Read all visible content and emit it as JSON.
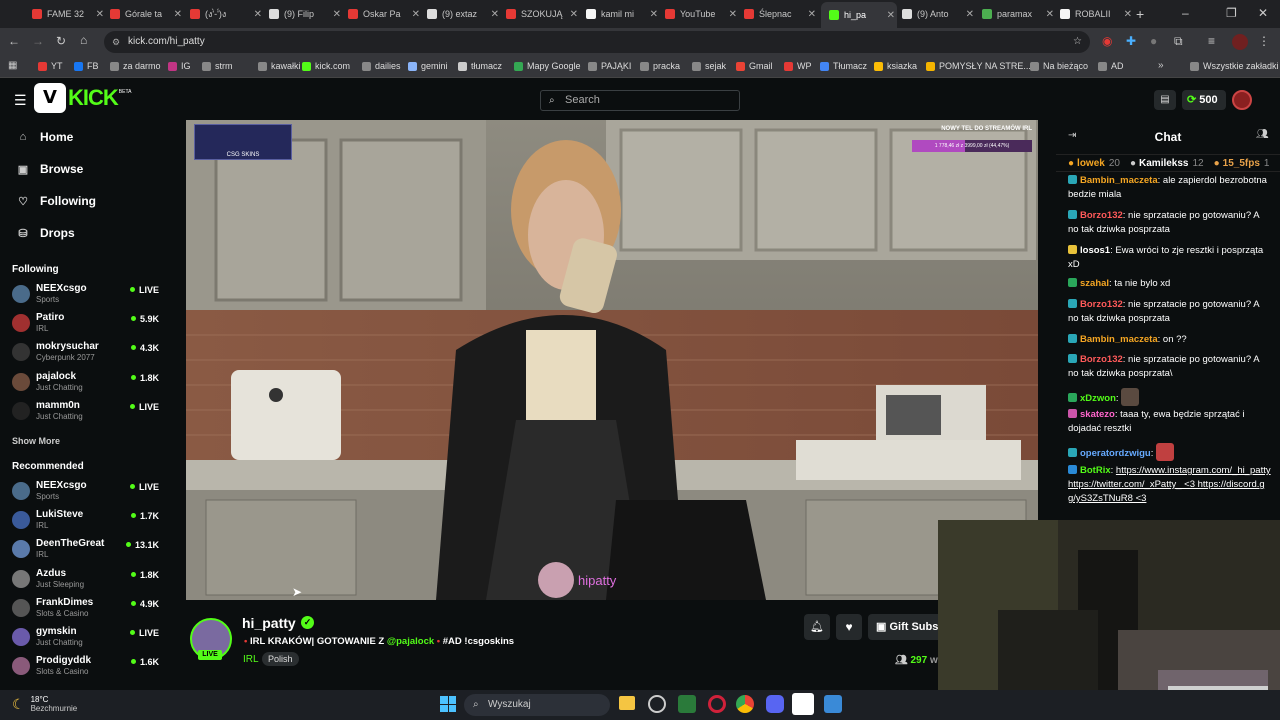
{
  "tabs": [
    {
      "label": "FAME 32",
      "color": "#e53935"
    },
    {
      "label": "Górale ta",
      "color": "#e53935"
    },
    {
      "label": "(ง'̀-'́)ง",
      "color": "#e53935"
    },
    {
      "label": "(9) Filip",
      "color": "#dddddd"
    },
    {
      "label": "Oskar Pa",
      "color": "#e53935"
    },
    {
      "label": "(9) extaz",
      "color": "#dddddd"
    },
    {
      "label": "SZOKUJĄ",
      "color": "#e53935"
    },
    {
      "label": "kamil mi",
      "color": "#f5f5f5"
    },
    {
      "label": "YouTube",
      "color": "#e53935"
    },
    {
      "label": "Ślepnac",
      "color": "#e53935"
    },
    {
      "label": "hi_pa",
      "color": "#53fc18"
    },
    {
      "label": "(9) Anto",
      "color": "#dddddd"
    },
    {
      "label": "paramax",
      "color": "#4caf50"
    },
    {
      "label": "ROBALII",
      "color": "#f5f5f5"
    }
  ],
  "address": {
    "url": "kick.com/hi_patty"
  },
  "bookmarks": [
    {
      "label": "YT",
      "color": "#e53935"
    },
    {
      "label": "FB",
      "color": "#1877f2"
    },
    {
      "label": "za darmo",
      "color": "#888888"
    },
    {
      "label": "IG",
      "color": "#c13584"
    },
    {
      "label": "strm",
      "color": "#888888"
    },
    {
      "label": "kawałki",
      "color": "#888888"
    },
    {
      "label": "kick.com",
      "color": "#53fc18"
    },
    {
      "label": "dailies",
      "color": "#888888"
    },
    {
      "label": "gemini",
      "color": "#8ab4f8"
    },
    {
      "label": "tłumacz",
      "color": "#cccccc"
    },
    {
      "label": "Mapy Google",
      "color": "#34a853"
    },
    {
      "label": "PAJĄKI",
      "color": "#888888"
    },
    {
      "label": "pracka",
      "color": "#888888"
    },
    {
      "label": "sejak",
      "color": "#888888"
    },
    {
      "label": "Gmail",
      "color": "#ea4335"
    },
    {
      "label": "WP",
      "color": "#e53935"
    },
    {
      "label": "Tłumacz",
      "color": "#4285f4"
    },
    {
      "label": "ksiazka",
      "color": "#fbbc05"
    },
    {
      "label": "POMYSŁY NA STRE...",
      "color": "#f4b400"
    },
    {
      "label": "Na bieżąco",
      "color": "#888888"
    },
    {
      "label": "AD",
      "color": "#888888"
    },
    {
      "label": "Wszystkie zakładki",
      "color": "#888888"
    }
  ],
  "header": {
    "logo_text": "KICK",
    "logo_badge": "BETA",
    "search_placeholder": "Search",
    "points": "500"
  },
  "nav": [
    {
      "label": "Home",
      "icon": "home-icon"
    },
    {
      "label": "Browse",
      "icon": "browse-icon"
    },
    {
      "label": "Following",
      "icon": "heart-icon"
    },
    {
      "label": "Drops",
      "icon": "drops-icon"
    }
  ],
  "following": {
    "title": "Following",
    "show_more": "Show More",
    "items": [
      {
        "name": "NEEXcsgo",
        "category": "Sports",
        "viewers": "LIVE",
        "color": "#4a6b8a"
      },
      {
        "name": "Patiro",
        "category": "IRL",
        "viewers": "5.9K",
        "color": "#a03030"
      },
      {
        "name": "mokrysuchar",
        "category": "Cyberpunk 2077",
        "viewers": "4.3K",
        "color": "#333333"
      },
      {
        "name": "pajalock",
        "category": "Just Chatting",
        "viewers": "1.8K",
        "color": "#6a4a3a"
      },
      {
        "name": "mamm0n",
        "category": "Just Chatting",
        "viewers": "LIVE",
        "color": "#222222"
      }
    ]
  },
  "recommended": {
    "title": "Recommended",
    "items": [
      {
        "name": "NEEXcsgo",
        "category": "Sports",
        "viewers": "LIVE",
        "color": "#4a6b8a"
      },
      {
        "name": "LukiSteve",
        "category": "IRL",
        "viewers": "1.7K",
        "color": "#3a5a9a"
      },
      {
        "name": "DeenTheGreat",
        "category": "IRL",
        "viewers": "13.1K",
        "color": "#5a7aaa"
      },
      {
        "name": "Azdus",
        "category": "Just Sleeping",
        "viewers": "1.8K",
        "color": "#777777"
      },
      {
        "name": "FrankDimes",
        "category": "Slots & Casino",
        "viewers": "4.9K",
        "color": "#555555"
      },
      {
        "name": "gymskin",
        "category": "Just Chatting",
        "viewers": "LIVE",
        "color": "#6a5aaa"
      },
      {
        "name": "Prodigyddk",
        "category": "Slots & Casino",
        "viewers": "1.6K",
        "color": "#8a5a7a"
      }
    ]
  },
  "video": {
    "overlay_top_right": "NOWY TEL DO STREAMÓW IRL",
    "overlay_progress_text": "1 778,46 zł z 3999,00 zł (44,47%)",
    "overlay_progress": 0.4447,
    "overlay_logo": "CSG SKINS",
    "watermark": "hipatty"
  },
  "stream": {
    "channel": "hi_patty",
    "title_prefix": "IRL KRAKÓW| GOTOWANIE Z",
    "mention": "@pajalock",
    "title_suffix": "#AD !csgoskins",
    "category": "IRL",
    "tag": "Polish",
    "live_badge": "LIVE",
    "viewers": "297",
    "viewers_suffix": "wa",
    "gift_label": "Gift Subs"
  },
  "chat": {
    "title": "Chat",
    "leaderboard": [
      {
        "name": "lowek",
        "count": "20",
        "color": "#f5a623"
      },
      {
        "name": "Kamilekss",
        "count": "12",
        "color": "#cccccc"
      },
      {
        "name": "15_5fps",
        "count": "1",
        "color": "#e8a24a"
      }
    ],
    "messages": [
      {
        "user": "Bambin_maczeta",
        "color": "#f5a623",
        "badge": "#2aa7b7",
        "text": "ale zapierdol bezrobotna bedzie miala"
      },
      {
        "user": "Borzo132",
        "color": "#ff5a5a",
        "badge": "#2aa7b7",
        "text": "nie sprzatacie po gotowaniu? A no tak dziwka posprzata"
      },
      {
        "user": "losos1",
        "color": "#ffffff",
        "badge": "#e8c23a",
        "text": "Ewa wróci to zje resztki i posprząta xD"
      },
      {
        "user": "szahal",
        "color": "#f5a623",
        "badge": "#2aa75b",
        "text": "ta nie bylo xd"
      },
      {
        "user": "Borzo132",
        "color": "#ff5a5a",
        "badge": "#2aa7b7",
        "text": "nie sprzatacie po gotowaniu? A no tak dziwka posprzata"
      },
      {
        "user": "Bambin_maczeta",
        "color": "#f5a623",
        "badge": "#2aa7b7",
        "text": "on ??"
      },
      {
        "user": "Borzo132",
        "color": "#ff5a5a",
        "badge": "#2aa7b7",
        "text": "nie sprzatacie po gotowaniu? A no tak dziwka posprzata\\"
      },
      {
        "user": "xDzwon",
        "color": "#53fc18",
        "badge": "#2aa75b",
        "text": ""
      },
      {
        "user": "skatezo",
        "color": "#ff66cc",
        "badge": "#cc55aa",
        "text": "taaa ty, ewa będzie sprzątać i dojadać resztki"
      },
      {
        "user": "operatordzwigu",
        "color": "#66aaff",
        "badge": "#2aa7b7",
        "text": ""
      },
      {
        "user": "BotRix",
        "color": "#53fc18",
        "badge": "#2a8ad7",
        "text": "https://www.instagram.com/_hi_patty https://twitter.com/_xPatty_ <3 https://discord.gg/yS3ZsTNuR8 <3"
      }
    ]
  },
  "taskbar": {
    "weather_temp": "18°C",
    "weather_desc": "Bezchmurnie",
    "search_placeholder": "Wyszukaj"
  }
}
